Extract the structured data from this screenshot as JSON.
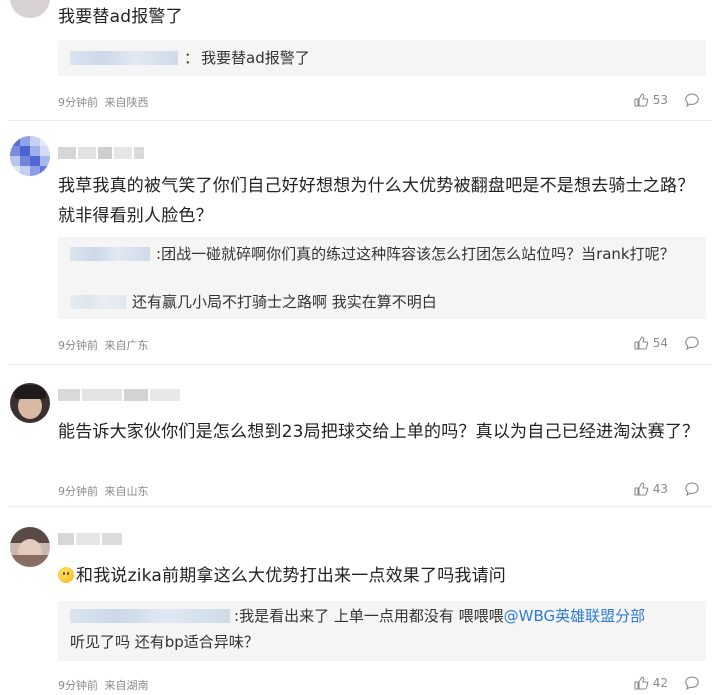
{
  "comments": [
    {
      "text": "我要替ad报警了",
      "quote": [
        {
          "prefix": "：",
          "text": "我要替ad报警了"
        }
      ],
      "time": "9分钟前",
      "location": "来自陕西",
      "likes": "53"
    },
    {
      "text": "我草我真的被气笑了你们自己好好想想为什么大优势被翻盘吧是不是想去骑士之路？就非得看别人脸色？",
      "quote": [
        {
          "prefix": ":",
          "text": "团战一碰就碎啊你们真的练过这种阵容该怎么打团怎么站位吗？当rank打呢？"
        },
        {
          "prefix": "",
          "text": "还有赢几小局不打骑士之路啊 我实在算不明白"
        }
      ],
      "time": "9分钟前",
      "location": "来自广东",
      "likes": "54"
    },
    {
      "text": "能告诉大家伙你们是怎么想到23局把球交给上单的吗？真以为自己已经进淘汰赛了？",
      "time": "9分钟前",
      "location": "来自山东",
      "likes": "43"
    },
    {
      "text": "和我说zika前期拿这么大优势打出来一点效果了吗我请问",
      "quote": [
        {
          "prefix": ":",
          "text": "我是看出来了 上单一点用都没有 喂喂喂",
          "mention": "@WBG英雄联盟分部",
          "cont": "听见了吗 还有bp适合异味？"
        }
      ],
      "time": "9分钟前",
      "location": "来自湖南",
      "likes": "42"
    }
  ],
  "icons": {
    "like": "thumbs-up-icon",
    "reply": "comment-bubble-icon",
    "emoji": "smile-emoji-icon"
  },
  "colors": {
    "mention": "#2b7bd6",
    "meta": "#8a8a8a",
    "quote_bg": "#f5f5f5"
  }
}
